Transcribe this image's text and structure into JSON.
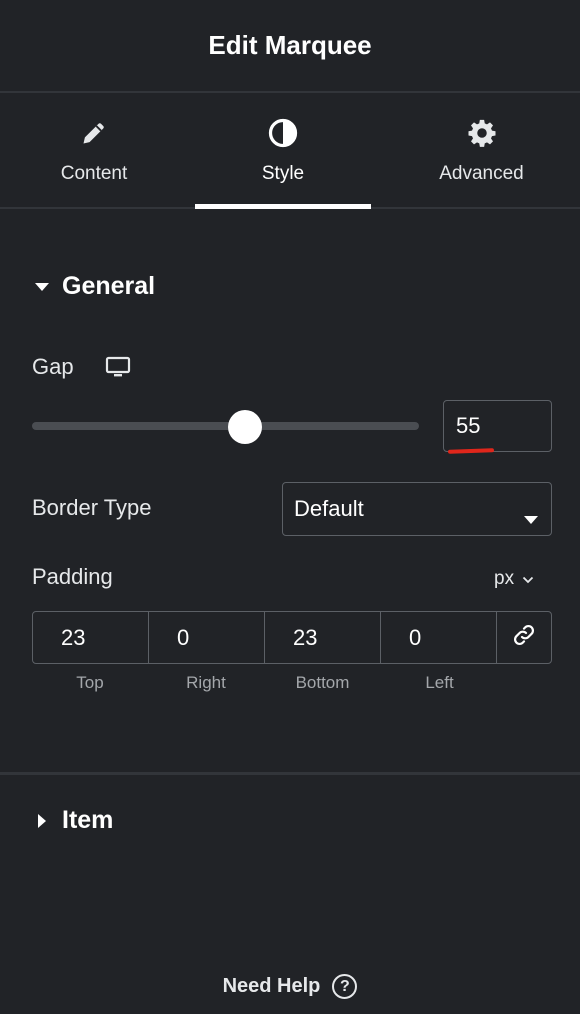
{
  "header": {
    "title": "Edit Marquee"
  },
  "tabs": [
    {
      "label": "Content",
      "icon": "pencil-icon"
    },
    {
      "label": "Style",
      "icon": "half-circle-icon",
      "active": true
    },
    {
      "label": "Advanced",
      "icon": "gear-icon"
    }
  ],
  "general": {
    "title": "General",
    "gap": {
      "label": "Gap",
      "value": "55",
      "device_icon": "desktop-icon",
      "slider_fraction": 0.55
    },
    "border_type": {
      "label": "Border Type",
      "value": "Default"
    },
    "padding": {
      "label": "Padding",
      "unit": "px",
      "top": "23",
      "right": "0",
      "bottom": "23",
      "left": "0",
      "top_label": "Top",
      "right_label": "Right",
      "bottom_label": "Bottom",
      "left_label": "Left",
      "link_icon": "link-icon"
    }
  },
  "item": {
    "title": "Item"
  },
  "footer": {
    "help_label": "Need Help",
    "help_icon": "question-icon"
  },
  "colors": {
    "background": "#212327",
    "accent": "#ffffff",
    "annotation": "#e0261b"
  }
}
